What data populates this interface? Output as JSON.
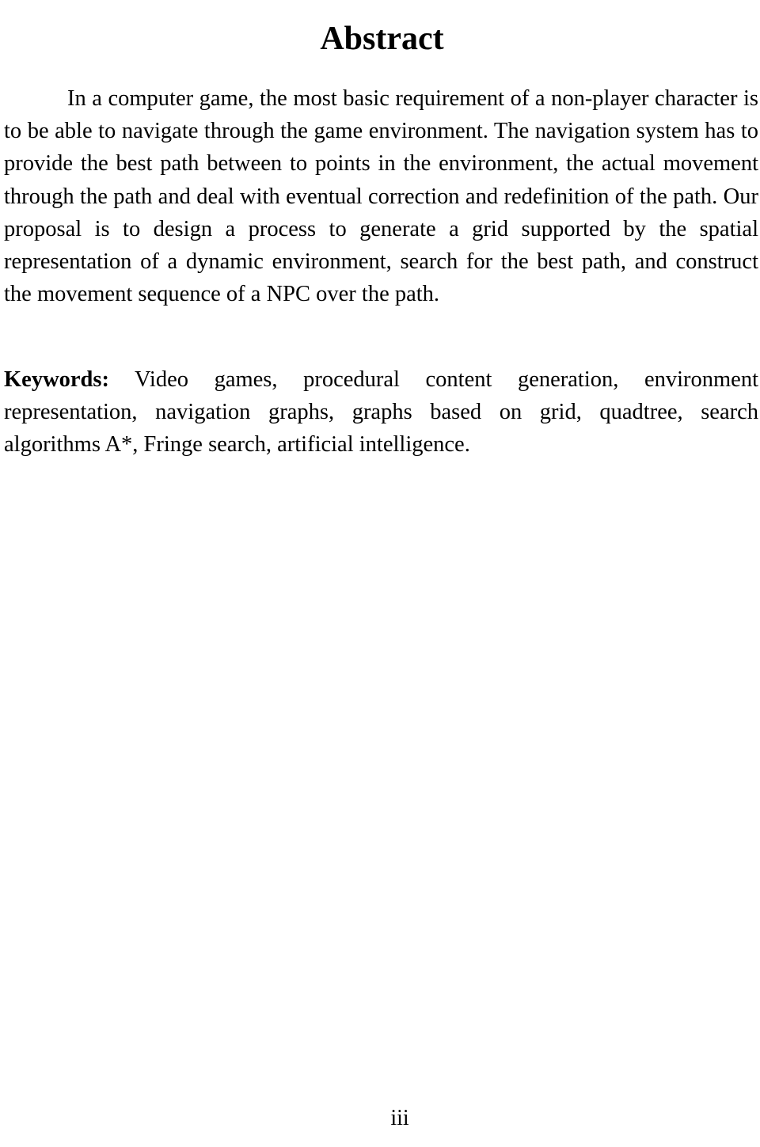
{
  "document": {
    "title": "Abstract",
    "abstract": {
      "paragraph": "In a computer game, the most basic requirement of a non-player character is to be able to navigate through the game environment. The navigation system has to provide the best path between to points in the environment, the actual movement through the path and deal with eventual correction and redefinition of the path. Our proposal is to design a process to generate a grid supported by the spatial representation of a dynamic environment, search for the best path, and construct the movement sequence of a NPC over the path."
    },
    "keywords": {
      "label": "Keywords:",
      "text": " Video games, procedural content generation, environment representation, navigation graphs, graphs based on grid, quadtree, search algorithms A*, Fringe search, artificial intelligence.",
      "terms": [
        "Video games",
        "procedural content generation",
        "environment representation",
        "navigation graphs",
        "graphs based on grid",
        "quadtree",
        "search algorithms A*",
        "Fringe search",
        "artificial intelligence"
      ]
    },
    "footer": {
      "page_number": "iii"
    },
    "colors": {
      "text": "#000000",
      "background": "#ffffff"
    }
  }
}
